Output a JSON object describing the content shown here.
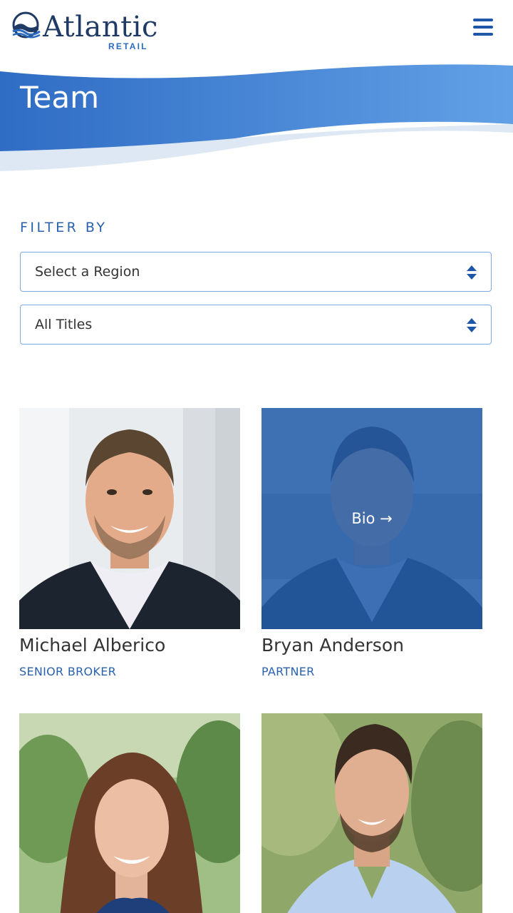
{
  "header": {
    "logo_text": "Atlantic",
    "logo_subtext": "RETAIL",
    "menu_icon": "hamburger-menu-icon"
  },
  "hero": {
    "title": "Team"
  },
  "filter": {
    "label": "FILTER BY",
    "region_select": {
      "value": "Select a Region",
      "icon": "sort-arrows-icon"
    },
    "title_select": {
      "value": "All Titles",
      "icon": "sort-arrows-icon"
    }
  },
  "team": [
    {
      "name": "Michael Alberico",
      "title": "SENIOR BROKER"
    },
    {
      "name": "Bryan Anderson",
      "title": "PARTNER",
      "bio_label": "Bio →"
    },
    {
      "name": "",
      "title": ""
    },
    {
      "name": "",
      "title": ""
    }
  ],
  "colors": {
    "brand_navy": "#1f3a64",
    "brand_blue": "#2a62ad",
    "hero_blue": "#3a7bd0",
    "overlay_blue": "#235faf"
  }
}
